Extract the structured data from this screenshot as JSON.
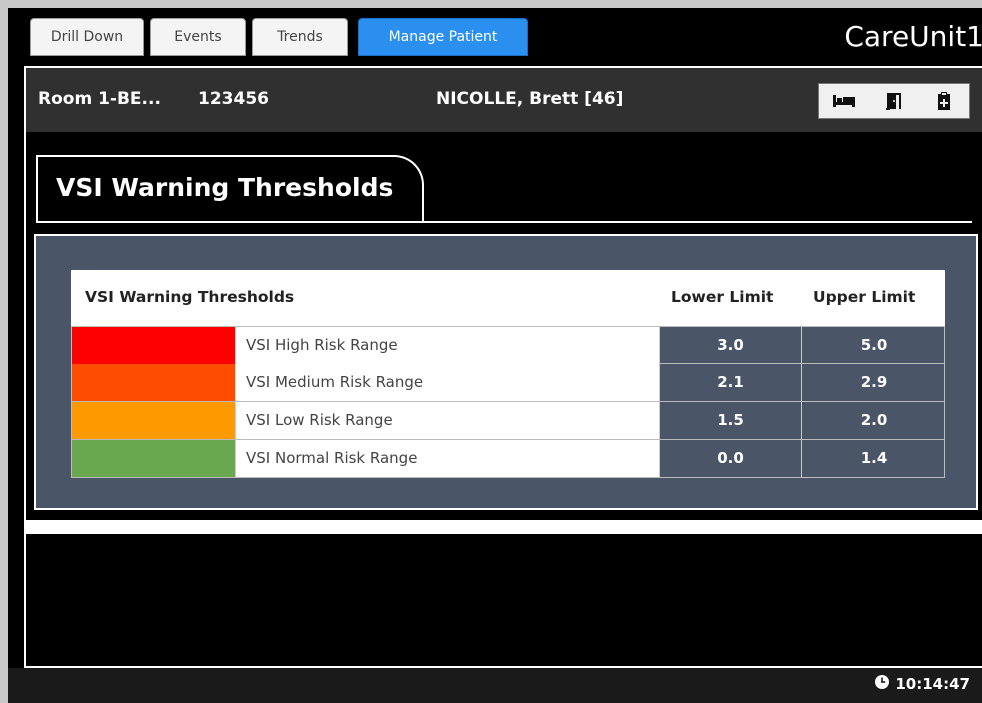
{
  "tabs": [
    {
      "label": "Drill Down"
    },
    {
      "label": "Events"
    },
    {
      "label": "Trends"
    },
    {
      "label": "Manage Patient"
    }
  ],
  "active_tab": "Manage Patient",
  "brand": "CareUnit1",
  "patient": {
    "room": "Room 1-BE...",
    "mrn": "123456",
    "name": "NICOLLE, Brett [46]",
    "buttons": [
      {
        "icon": "bed-icon"
      },
      {
        "icon": "door-exit-icon"
      },
      {
        "icon": "clipboard-icon"
      }
    ]
  },
  "section": {
    "title": "VSI Warning Thresholds"
  },
  "table": {
    "header": {
      "name": "VSI Warning Thresholds",
      "lower": "Lower Limit",
      "upper": "Upper Limit"
    },
    "rows": [
      {
        "label": "VSI High Risk Range",
        "color": "#ff0000",
        "lower": "3.0",
        "upper": "5.0"
      },
      {
        "label": "VSI Medium Risk Range",
        "color": "#ff4d00",
        "lower": "2.1",
        "upper": "2.9"
      },
      {
        "label": "VSI Low Risk Range",
        "color": "#ff9900",
        "lower": "1.5",
        "upper": "2.0"
      },
      {
        "label": "VSI Normal Risk Range",
        "color": "#6aa84f",
        "lower": "0.0",
        "upper": "1.4"
      }
    ]
  },
  "status": {
    "time": "10:14:47",
    "clock_icon": "clock-icon"
  },
  "colors": {
    "tab_active": "#2b8ff0",
    "panel": "#4a5568"
  }
}
